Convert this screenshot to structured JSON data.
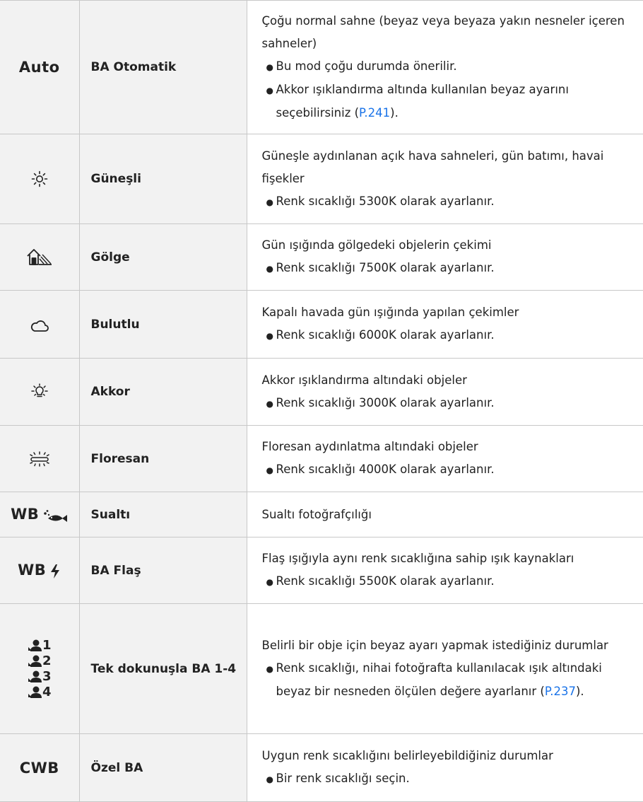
{
  "rows": [
    {
      "icon": "Auto",
      "name": "BA Otomatik",
      "desc": "Çoğu normal sahne (beyaz veya beyaza yakın nesneler içeren sahneler)",
      "bullets": [
        "Bu mod çoğu durumda önerilir."
      ],
      "bullet2_pre": "Akkor ışıklandırma altında kullanılan beyaz ayarını seçebilirsiniz (",
      "bullet2_link": "P.241",
      "bullet2_post": ")."
    },
    {
      "icon_name": "sun-icon",
      "name": "Güneşli",
      "desc": "Güneşle aydınlanan açık hava sahneleri, gün batımı, havai fişekler",
      "bullets": [
        "Renk sıcaklığı 5300K olarak ayarlanır."
      ]
    },
    {
      "icon_name": "shade-icon",
      "name": "Gölge",
      "desc": "Gün ışığında gölgedeki objelerin çekimi",
      "bullets": [
        "Renk sıcaklığı 7500K olarak ayarlanır."
      ]
    },
    {
      "icon_name": "cloud-icon",
      "name": "Bulutlu",
      "desc": "Kapalı havada gün ışığında yapılan çekimler",
      "bullets": [
        "Renk sıcaklığı 6000K olarak ayarlanır."
      ]
    },
    {
      "icon_name": "incandescent-icon",
      "name": "Akkor",
      "desc": "Akkor ışıklandırma altındaki objeler",
      "bullets": [
        "Renk sıcaklığı 3000K olarak ayarlanır."
      ]
    },
    {
      "icon_name": "fluorescent-icon",
      "name": "Floresan",
      "desc": "Floresan aydınlatma altındaki objeler",
      "bullets": [
        "Renk sıcaklığı 4000K olarak ayarlanır."
      ]
    },
    {
      "icon_prefix": "WB",
      "icon_name": "underwater-fish-icon",
      "name": "Sualtı",
      "desc": "Sualtı fotoğrafçılığı"
    },
    {
      "icon_prefix": "WB",
      "icon_name": "flash-icon",
      "name": "BA Flaş",
      "desc": "Flaş ışığıyla aynı renk sıcaklığına sahip ışık kaynakları",
      "bullets": [
        "Renk sıcaklığı 5500K olarak ayarlanır."
      ]
    },
    {
      "icon_name": "one-touch-wb-icon",
      "icon_nums": [
        "1",
        "2",
        "3",
        "4"
      ],
      "name": "Tek dokunuşla BA 1-4",
      "desc": "Belirli bir obje için beyaz ayarı yapmak istediğiniz durumlar",
      "bullet_pre": "Renk sıcaklığı, nihai fotoğrafta kullanılacak ışık altındaki beyaz bir nesneden ölçülen değere ayarlanır (",
      "bullet_link": "P.237",
      "bullet_post": ")."
    },
    {
      "icon": "CWB",
      "name": "Özel BA",
      "desc": "Uygun renk sıcaklığını belirleyebildiğiniz durumlar",
      "bullets": [
        "Bir renk sıcaklığı seçin."
      ]
    }
  ],
  "colors": {
    "link": "#1a73e8",
    "header_bg": "#f2f2f2",
    "border": "#c8c8c8"
  }
}
